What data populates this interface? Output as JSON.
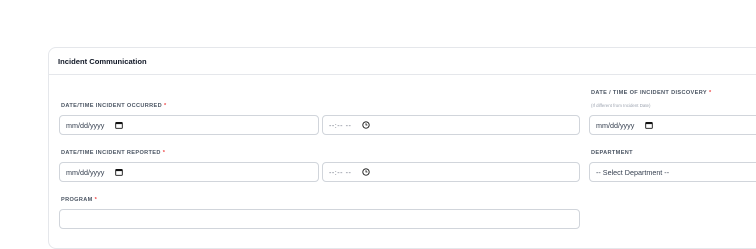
{
  "card": {
    "title": "Incident Communication"
  },
  "fields": {
    "occurred": {
      "label": "DATE/TIME INCIDENT OCCURRED",
      "required_mark": "*",
      "date_value": "mm/dd/yyyy",
      "time_value": "--:-- --",
      "date_icon": "calendar-icon",
      "time_icon": "clock-icon"
    },
    "discovery": {
      "label": "DATE / TIME OF INCIDENT DISCOVERY",
      "required_mark": "*",
      "hint": "(If different from Incident Date)",
      "date_value": "mm/dd/yyyy",
      "date_icon": "calendar-icon"
    },
    "reported": {
      "label": "DATE/TIME INCIDENT REPORTED",
      "required_mark": "*",
      "date_value": "mm/dd/yyyy",
      "time_value": "--:-- --",
      "date_icon": "calendar-icon",
      "time_icon": "clock-icon"
    },
    "department": {
      "label": "DEPARTMENT",
      "selected": "-- Select Department --"
    },
    "program": {
      "label": "PROGRAM",
      "required_mark": "*"
    }
  },
  "colors": {
    "required": "#ef4444",
    "border": "#d1d5db",
    "label": "#4b5563"
  }
}
